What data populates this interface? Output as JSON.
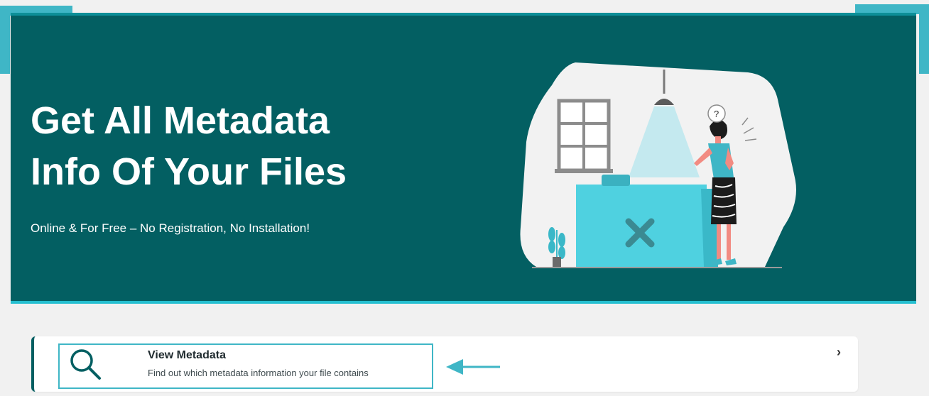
{
  "hero": {
    "title_line1": "Get All Metadata",
    "title_line2": "Info Of Your Files",
    "subtitle": "Online & For Free – No Registration, No Installation!",
    "background_color": "#035f62",
    "illustration_icon": "woman-at-desk-illustration"
  },
  "feature_card": {
    "title": "View Metadata",
    "description": "Find out which metadata information your file contains",
    "icon": "search-icon",
    "chevron": "›",
    "highlight_color": "#3fb6c6"
  },
  "annotation": {
    "icon": "arrow-left-icon",
    "color": "#3fb6c6"
  }
}
